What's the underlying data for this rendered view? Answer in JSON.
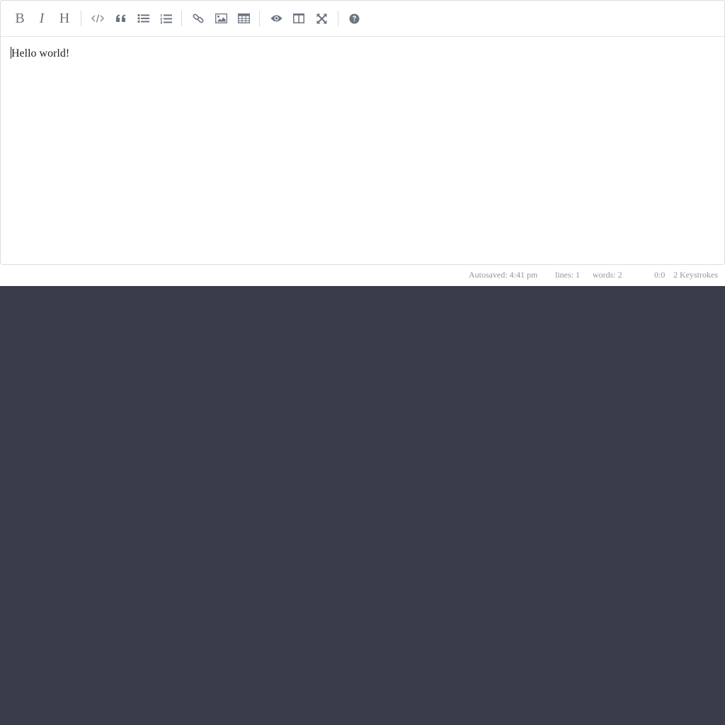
{
  "editor": {
    "content_text": "Hello world!"
  },
  "toolbar": {
    "bold_label": "B",
    "italic_label": "I",
    "heading_label": "H",
    "buttons": [
      "bold-icon",
      "italic-icon",
      "heading-icon",
      "code-icon",
      "quote-icon",
      "unordered-list-icon",
      "ordered-list-icon",
      "link-icon",
      "image-icon",
      "table-icon",
      "preview-eye-icon",
      "side-by-side-icon",
      "fullscreen-icon",
      "help-icon"
    ]
  },
  "statusbar": {
    "autosave": "Autosaved: 4:41 pm",
    "lines": "lines: 1",
    "words": "words: 2",
    "cursor": "0:0",
    "keystrokes": "2 Keystrokes"
  },
  "colors": {
    "icon": "#6b7480",
    "background_dark": "#383d49",
    "status_text": "#959595"
  }
}
